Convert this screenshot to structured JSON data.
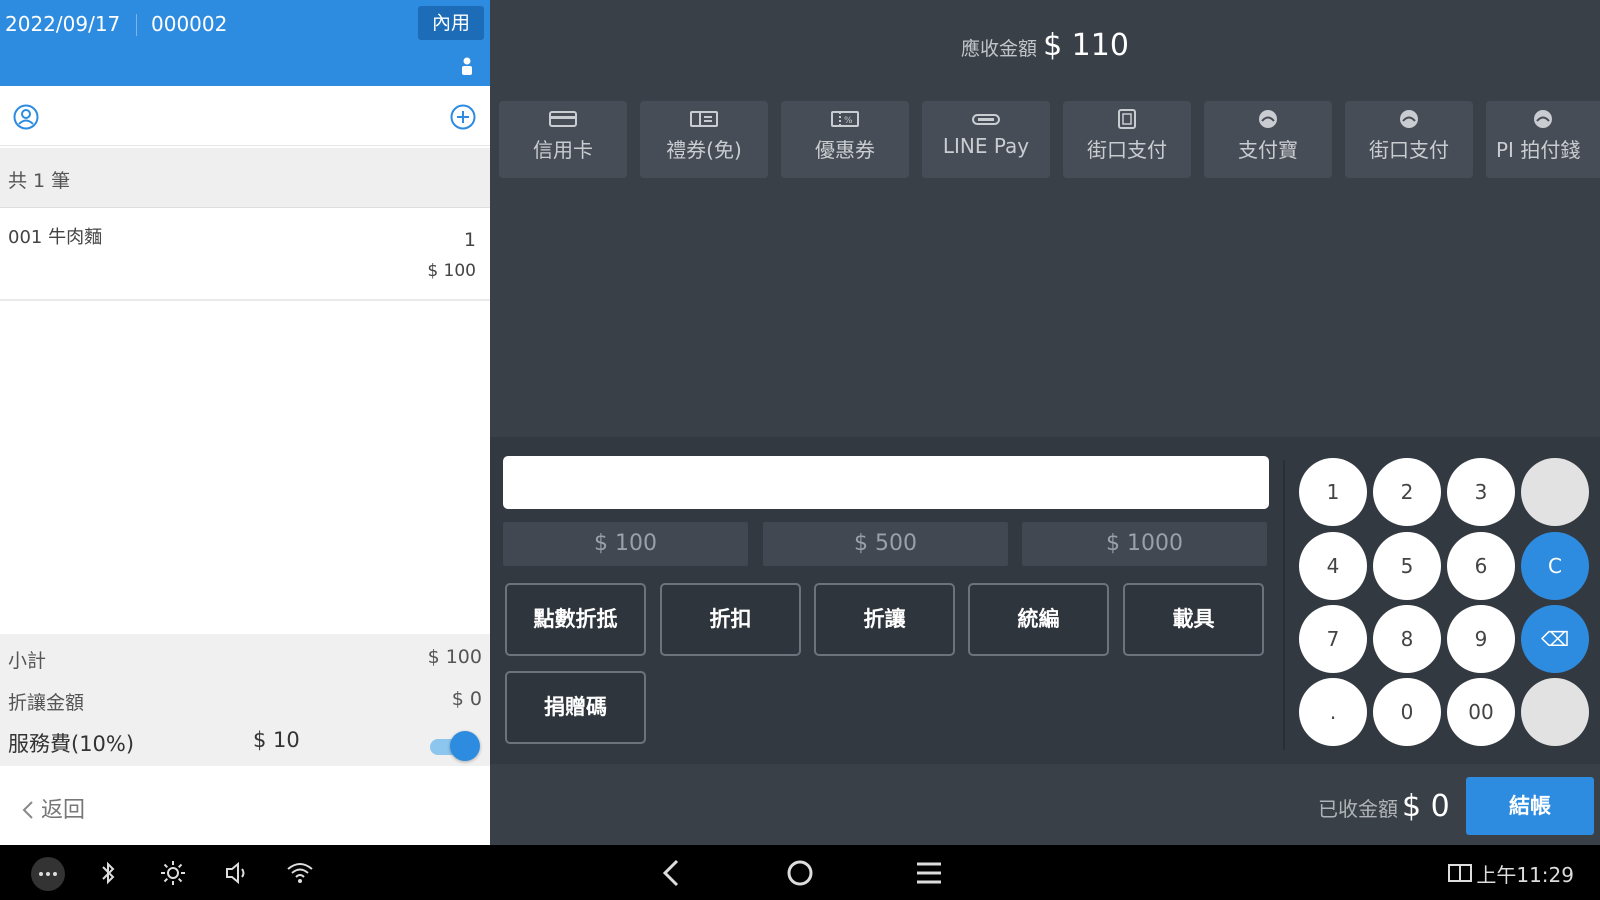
{
  "header": {
    "date": "2022/09/17",
    "order_no": "000002",
    "mode_badge": "內用"
  },
  "order": {
    "count_label": "共 1 筆",
    "items": [
      {
        "name": "001 牛肉麵",
        "qty": "1",
        "price": "$ 100"
      }
    ]
  },
  "summary": {
    "subtotal_label": "小計",
    "subtotal": "$ 100",
    "discount_label": "折讓金額",
    "discount": "$ 0",
    "service_label": "服務費(10%)",
    "service": "$ 10",
    "service_enabled": true
  },
  "back_label": "返回",
  "due": {
    "label": "應收金額",
    "amount": "$ 110"
  },
  "payment_methods": [
    {
      "label": "信用卡",
      "icon": "credit-card-icon"
    },
    {
      "label": "禮券(免)",
      "icon": "gift-voucher-icon"
    },
    {
      "label": "優惠券",
      "icon": "coupon-icon"
    },
    {
      "label": "LINE Pay",
      "icon": "line-pay-icon"
    },
    {
      "label": "街口支付",
      "icon": "jko-pay-icon"
    },
    {
      "label": "支付寶",
      "icon": "alipay-icon"
    },
    {
      "label": "街口支付",
      "icon": "jko-pay-icon"
    },
    {
      "label": "PI 拍付錢",
      "icon": "pi-wallet-icon"
    }
  ],
  "quick_amounts": [
    "$ 100",
    "$ 500",
    "$ 1000"
  ],
  "functions": [
    "點數折抵",
    "折扣",
    "折讓",
    "統編",
    "載具",
    "捐贈碼"
  ],
  "keypad": [
    [
      "1",
      "2",
      "3",
      ""
    ],
    [
      "4",
      "5",
      "6",
      "C"
    ],
    [
      "7",
      "8",
      "9",
      "⌫"
    ],
    [
      ".",
      "0",
      "00",
      ""
    ]
  ],
  "received": {
    "label": "已收金額",
    "amount": "$ 0"
  },
  "settle_label": "結帳",
  "statusbar": {
    "time": "上午11:29"
  },
  "colors": {
    "accent": "#2e8ce0",
    "panel": "#3a4048"
  }
}
